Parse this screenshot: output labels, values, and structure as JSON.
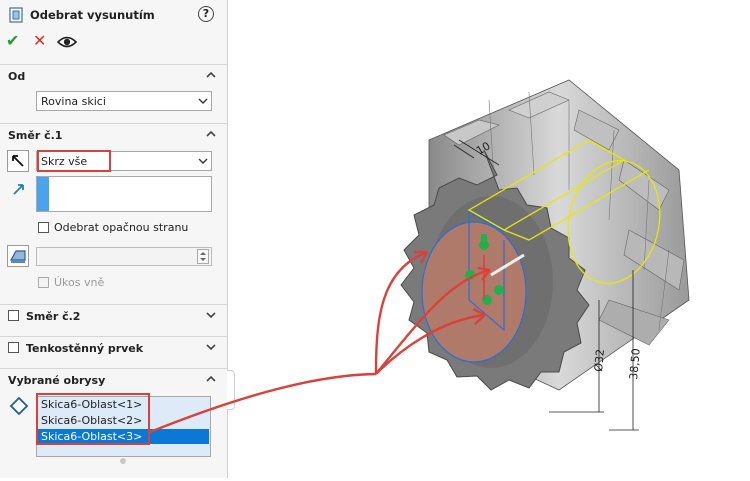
{
  "panel": {
    "title": "Odebrat vysunutím",
    "help_glyph": "?",
    "actions": {
      "ok_glyph": "✔",
      "cancel_glyph": "✕"
    }
  },
  "od": {
    "header": "Od",
    "value": "Rovina skici"
  },
  "smer1": {
    "header": "Směr č.1",
    "end_condition": "Skrz vše",
    "flip_side_label": "Odebrat opačnou stranu",
    "draft_label": "Úkos vně"
  },
  "smer2": {
    "header": "Směr č.2"
  },
  "thin": {
    "header": "Tenkostěnný prvek"
  },
  "contours": {
    "header": "Vybrané obrysy",
    "items": [
      "Skica6-Oblast<1>",
      "Skica6-Oblast<2>",
      "Skica6-Oblast<3>"
    ],
    "selected_index": 2
  },
  "model": {
    "dimensions": [
      "10",
      "Ø32",
      "38,50"
    ],
    "colors": {
      "annotation": "#d9413a",
      "sketch": "#e8e800",
      "selection": "#2a6fd6",
      "profile_fill": "#b07a6a"
    }
  }
}
